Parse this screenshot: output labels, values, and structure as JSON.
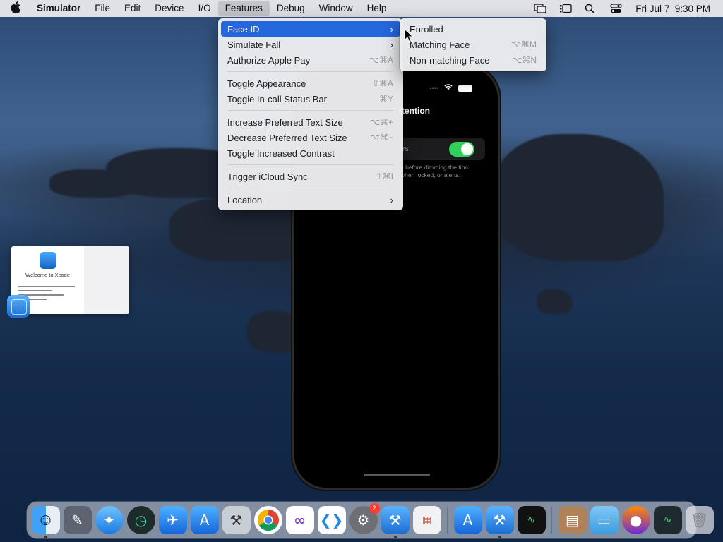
{
  "menubar": {
    "app_name": "Simulator",
    "menus": [
      "File",
      "Edit",
      "Device",
      "I/O",
      "Features",
      "Debug",
      "Window",
      "Help"
    ],
    "clock": "Fri Jul 7  9:30 PM"
  },
  "features_menu": {
    "items": [
      {
        "label": "Face ID",
        "shortcut": "",
        "submenu": true,
        "highlighted": true
      },
      {
        "label": "Simulate Fall",
        "shortcut": "",
        "submenu": true
      },
      {
        "label": "Authorize Apple Pay",
        "shortcut": "⌥⌘A"
      },
      {
        "label": "Toggle Appearance",
        "shortcut": "⇧⌘A"
      },
      {
        "label": "Toggle In-call Status Bar",
        "shortcut": "⌘Y"
      },
      {
        "label": "Increase Preferred Text Size",
        "shortcut": "⌥⌘+"
      },
      {
        "label": "Decrease Preferred Text Size",
        "shortcut": "⌥⌘−"
      },
      {
        "label": "Toggle Increased Contrast",
        "shortcut": ""
      },
      {
        "label": "Trigger iCloud Sync",
        "shortcut": "⇧⌘I"
      },
      {
        "label": "Location",
        "shortcut": "",
        "submenu": true
      }
    ]
  },
  "faceid_submenu": {
    "items": [
      {
        "label": "Enrolled",
        "shortcut": ""
      },
      {
        "label": "Matching Face",
        "shortcut": "⌥⌘M"
      },
      {
        "label": "Non-matching Face",
        "shortcut": "⌥⌘N"
      }
    ]
  },
  "phone": {
    "heading": "ttention",
    "row_label": "es",
    "toggle_on": true,
    "footnote": "n before dimming the tion when locked, or alerts."
  },
  "xcode_window": {
    "title": "Welcome to Xcode"
  },
  "dock": {
    "settings_badge": "2"
  },
  "colors": {
    "highlight": "#2466dc",
    "toggle_on": "#30d158"
  }
}
